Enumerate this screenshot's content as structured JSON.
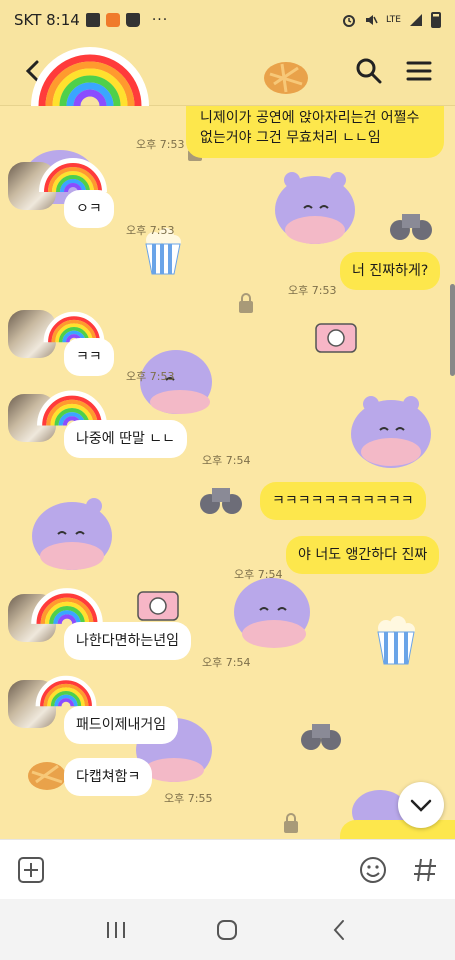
{
  "status_bar": {
    "carrier_time": "SKT 8:14",
    "more": "···",
    "network": "LTE"
  },
  "header": {
    "back_icon": "arrow-left-icon",
    "search_icon": "search-icon",
    "menu_icon": "hamburger-menu-icon"
  },
  "messages": [
    {
      "side": "out",
      "text": "니제이가 공연에 앉아자리는건 어쩔수 없는거야 그건 무효처리 ㄴㄴ임",
      "time": "오후 7:53"
    },
    {
      "side": "in",
      "text": "ㅇㅋ",
      "time": "오후 7:53"
    },
    {
      "side": "out",
      "text": "너 진짜하게?",
      "time": "오후 7:53"
    },
    {
      "side": "in",
      "text": "ㅋㅋ",
      "time": "오후 7:53"
    },
    {
      "side": "in",
      "text": "나중에 딴말 ㄴㄴ",
      "time": "오후 7:54"
    },
    {
      "side": "out",
      "text": "ㅋㅋㅋㅋㅋㅋㅋㅋㅋㅋㅋ",
      "time": ""
    },
    {
      "side": "out",
      "text": "야 너도 앵간하다 진짜",
      "time": "오후 7:54"
    },
    {
      "side": "in",
      "text": "나한다면하는년임",
      "time": "오후 7:54"
    },
    {
      "side": "in",
      "text": "패드이제내거임",
      "time": ""
    },
    {
      "side": "in",
      "text": "다캡쳐함ㅋ",
      "time": "오후 7:55"
    }
  ],
  "input_bar": {
    "plus_icon": "plus-square-icon",
    "emoji_icon": "emoji-icon",
    "hash_icon": "hash-icon",
    "placeholder": ""
  },
  "nav_bar": {
    "recents_icon": "recents-icon",
    "home_icon": "home-icon",
    "back_icon": "back-chevron-icon"
  },
  "colors": {
    "chat_bg": "#fbe7a4",
    "outgoing_bubble": "#fde74c",
    "incoming_bubble": "#ffffff",
    "header_bg": "#f8e4a0"
  }
}
